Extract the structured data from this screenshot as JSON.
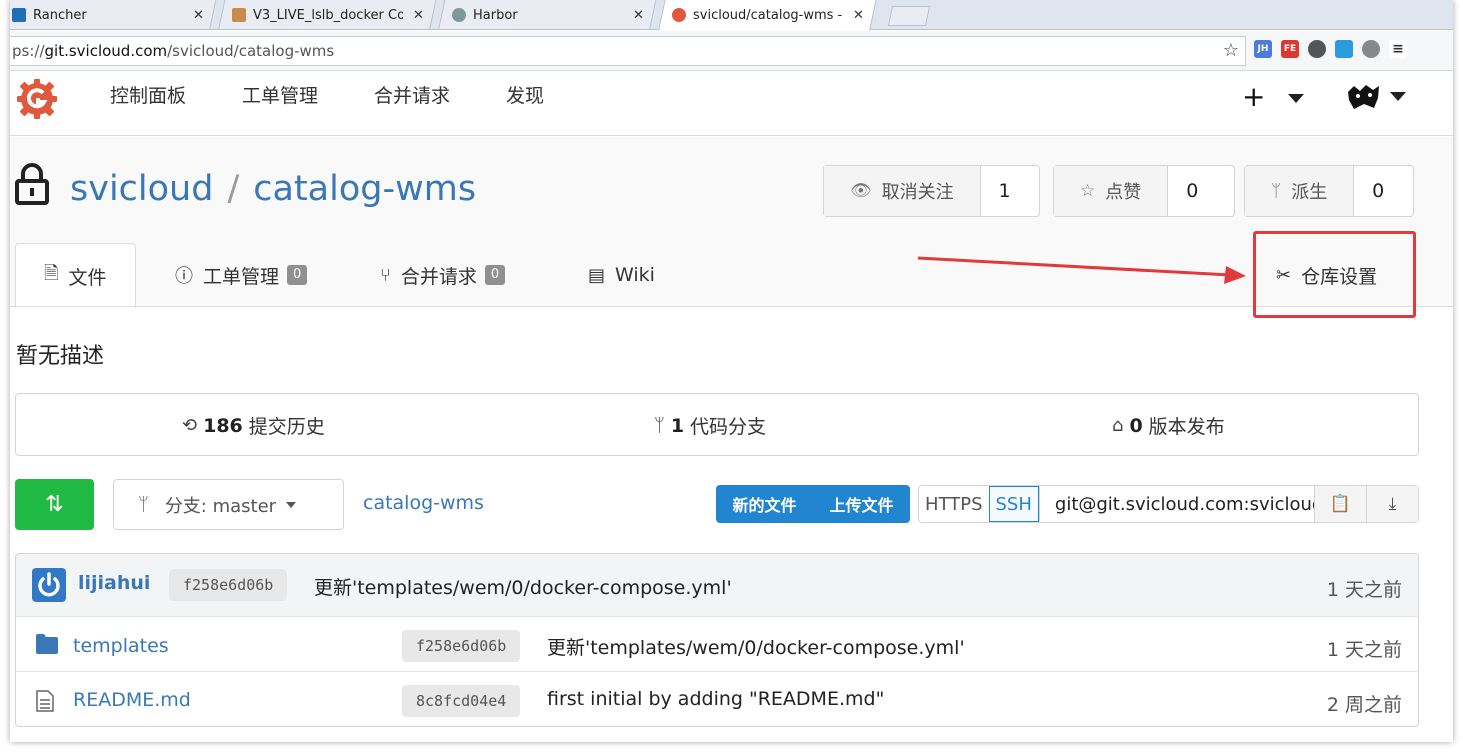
{
  "browser": {
    "tabs": [
      {
        "title": "Rancher",
        "fav_color": "#1f6fb5"
      },
      {
        "title": "V3_LIVE_lslb_docker Co",
        "fav_color": "#c98b4a"
      },
      {
        "title": "Harbor",
        "fav_color": "#7a9a9a"
      },
      {
        "title": "svicloud/catalog-wms -",
        "fav_color": "#e0593c"
      }
    ],
    "close_glyph": "✕",
    "address": {
      "scheme": "ps://",
      "host": "git.svicloud.com",
      "path": "/svicloud/catalog-wms"
    },
    "extensions": [
      "JH",
      "FE"
    ]
  },
  "topnav": {
    "items": [
      "控制面板",
      "工单管理",
      "合并请求",
      "发现"
    ],
    "plus": "+"
  },
  "repo": {
    "owner": "svicloud",
    "separator": "/",
    "name": "catalog-wms",
    "watch": {
      "label": "取消关注",
      "count": "1"
    },
    "star": {
      "label": "点赞",
      "count": "0"
    },
    "fork": {
      "label": "派生",
      "count": "0"
    },
    "tabs": {
      "files": "文件",
      "issues": "工单管理",
      "issues_count": "0",
      "pulls": "合并请求",
      "pulls_count": "0",
      "wiki": "Wiki",
      "settings": "仓库设置"
    },
    "description": "暂无描述",
    "stats": {
      "commits_count": "186",
      "commits_label": "提交历史",
      "branches_count": "1",
      "branches_label": "代码分支",
      "releases_count": "0",
      "releases_label": "版本发布"
    },
    "branch_label": "分支: master",
    "breadcrumb": "catalog-wms",
    "new_file": "新的文件",
    "upload_file": "上传文件",
    "clone": {
      "https": "HTTPS",
      "ssh": "SSH",
      "url": "git@git.svicloud.com:svicloud/catalog-wms.git"
    }
  },
  "latest_commit": {
    "author": "lijiahui",
    "sha": "f258e6d06b",
    "message": "更新'templates/wem/0/docker-compose.yml'",
    "time": "1 天之前"
  },
  "files": [
    {
      "name": "templates",
      "type": "folder",
      "sha": "f258e6d06b",
      "message": "更新'templates/wem/0/docker-compose.yml'",
      "time": "1 天之前"
    },
    {
      "name": "README.md",
      "type": "file",
      "sha": "8c8fcd04e4",
      "message": "first initial by adding \"README.md\"",
      "time": "2 周之前"
    }
  ],
  "colors": {
    "accent": "#3a78b5",
    "green": "#21ba45",
    "blue": "#2185d0",
    "annotation": "#e0393e"
  }
}
